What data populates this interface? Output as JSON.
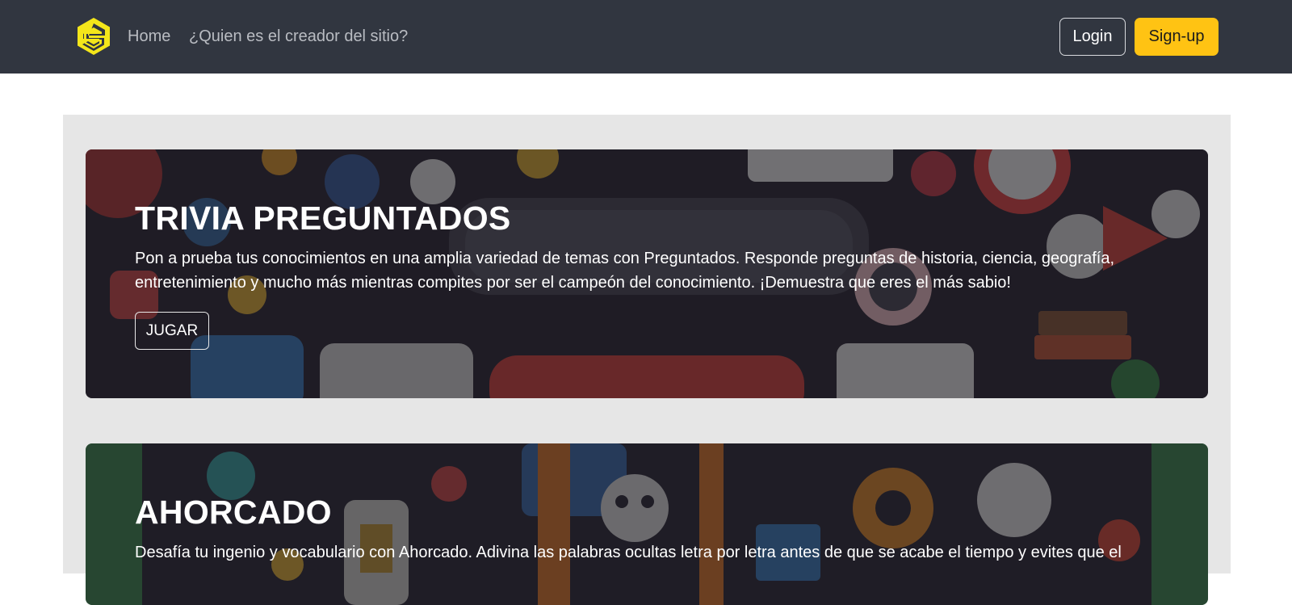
{
  "navbar": {
    "logo_icon": "s-hexagon-logo",
    "links": [
      {
        "label": "Home"
      },
      {
        "label": "¿Quien es el creador del sitio?"
      }
    ],
    "login_label": "Login",
    "signup_label": "Sign-up",
    "colors": {
      "background": "#313640",
      "accent": "#ffc313"
    }
  },
  "cards": [
    {
      "title": "TRIVIA PREGUNTADOS",
      "description": "Pon a prueba tus conocimientos en una amplia variedad de temas con Preguntados. Responde preguntas de historia, ciencia, geografía, entretenimiento y mucho más mientras compites por ser el campeón del conocimiento. ¡Demuestra que eres el más sabio!",
      "button_label": "JUGAR",
      "background_image": "trivia-quiz-illustration"
    },
    {
      "title": "AHORCADO",
      "description": "Desafía tu ingenio y vocabulario con Ahorcado. Adivina las palabras ocultas letra por letra antes de que se acabe el tiempo y evites que el",
      "background_image": "hangman-game-illustration"
    }
  ]
}
